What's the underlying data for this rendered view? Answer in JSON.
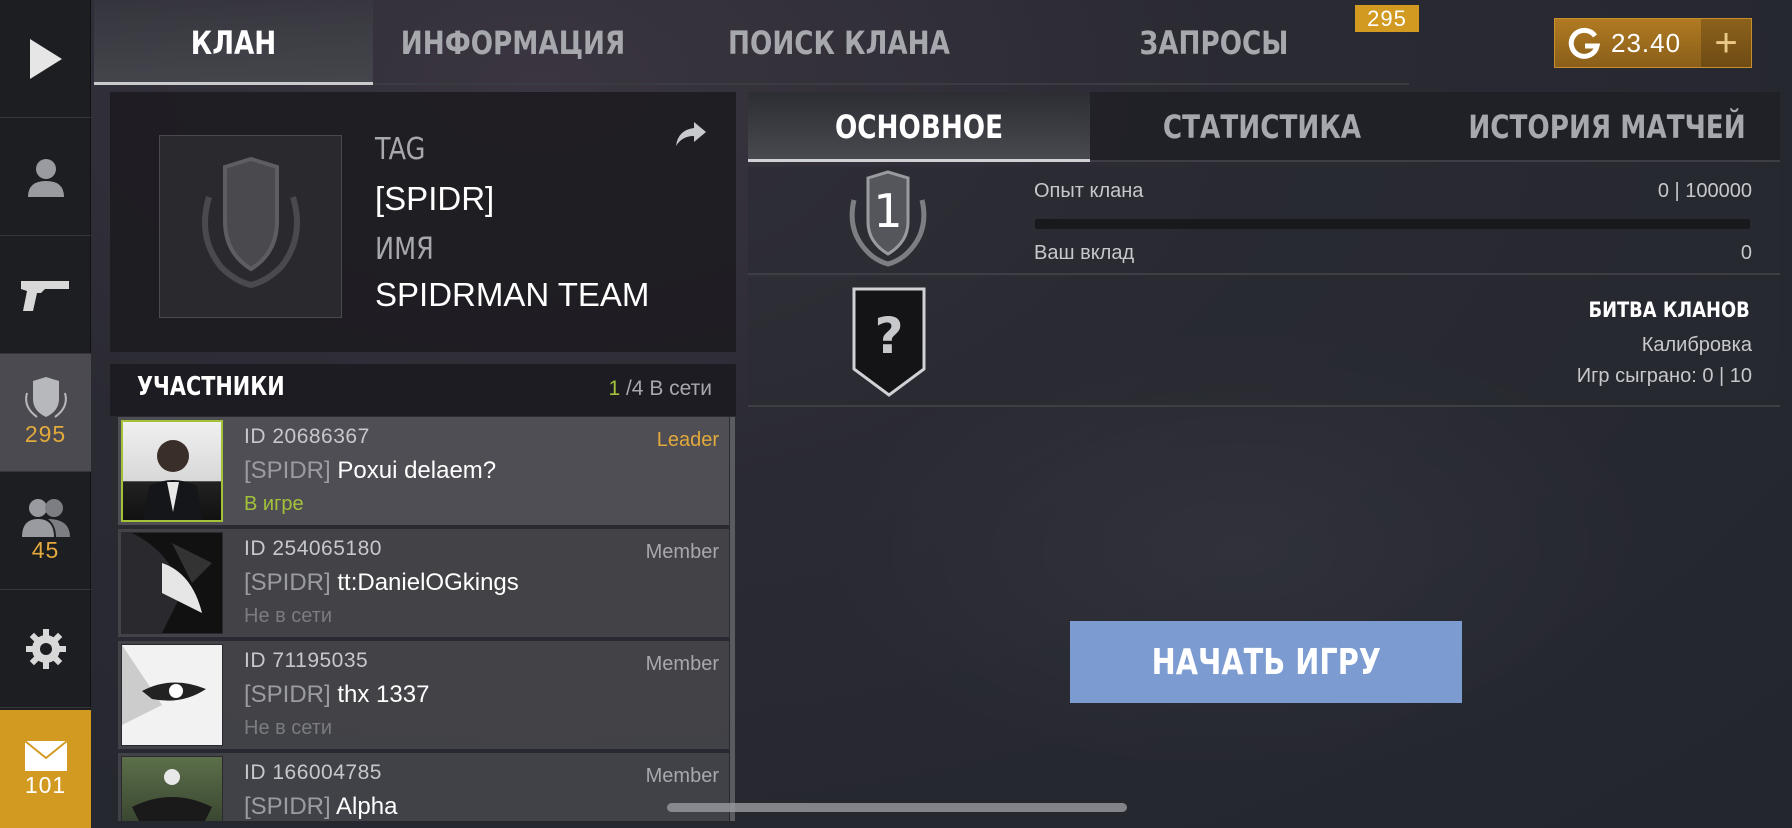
{
  "top_tabs": [
    {
      "label": "КЛАН"
    },
    {
      "label": "ИНФОРМАЦИЯ"
    },
    {
      "label": "ПОИСК КЛАНА"
    },
    {
      "label": "ЗАПРОСЫ"
    }
  ],
  "requests_badge": "295",
  "currency": {
    "value": "23.40",
    "plus": "+"
  },
  "sidebar": {
    "clan_count": "295",
    "friends_count": "45",
    "mail_count": "101"
  },
  "clan": {
    "tag_label": "TAG",
    "tag_value": "[SPIDR]",
    "name_label": "ИМЯ",
    "name_value": "SPIDRMAN TEAM"
  },
  "members": {
    "title": "УЧАСТНИКИ",
    "online_count": "1",
    "online_suffix": "/4 В сети",
    "list": [
      {
        "id": "ID 20686367",
        "tag": "[SPIDR]",
        "name": "Poxui delaem?",
        "status": "В игре",
        "role": "Leader"
      },
      {
        "id": "ID 254065180",
        "tag": "[SPIDR]",
        "name": "tt:DanielOGkings",
        "status": "Не в сети",
        "role": "Member"
      },
      {
        "id": "ID 71195035",
        "tag": "[SPIDR]",
        "name": "thx 1337",
        "status": "Не в сети",
        "role": "Member"
      },
      {
        "id": "ID 166004785",
        "tag": "[SPIDR]",
        "name": "Alpha",
        "status": "",
        "role": "Member"
      }
    ]
  },
  "right_tabs": [
    {
      "label": "ОСНОВНОЕ"
    },
    {
      "label": "СТАТИСТИКА"
    },
    {
      "label": "ИСТОРИЯ МАТЧЕЙ"
    }
  ],
  "clan_level": "1",
  "xp": {
    "label": "Опыт клана",
    "value": "0 | 100000",
    "fraction": 0
  },
  "contribution": {
    "label": "Ваш вклад",
    "value": "0"
  },
  "clan_battle": {
    "rank_glyph": "?",
    "title": "БИТВА КЛАНОВ",
    "status": "Калибровка",
    "games_played": "Игр сыграно: 0 | 10"
  },
  "start_button": "НАЧАТЬ ИГРУ",
  "colors": {
    "accent_gold": "#d39a21",
    "online_green": "#a3c23a",
    "start_blue": "#7b9bd1"
  }
}
